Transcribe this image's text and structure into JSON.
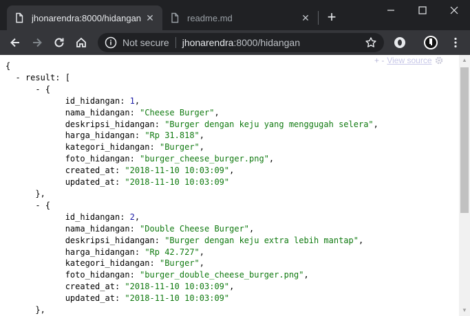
{
  "tabs": [
    {
      "title": "jhonarendra:8000/hidangan",
      "active": true
    },
    {
      "title": "readme.md",
      "active": false
    }
  ],
  "toolbar": {
    "security_label": "Not secure",
    "url_host": "jhonarendra",
    "url_rest": ":8000/hidangan"
  },
  "viewer": {
    "collapse_label": "+ -",
    "view_source_label": "View source"
  },
  "json_doc": {
    "result_key": "result",
    "items": [
      {
        "id_hidangan": "1",
        "nama_hidangan": "\"Cheese Burger\"",
        "deskripsi_hidangan": "\"Burger dengan keju yang menggugah selera\"",
        "harga_hidangan": "\"Rp 31.818\"",
        "kategori_hidangan": "\"Burger\"",
        "foto_hidangan": "\"burger_cheese_burger.png\"",
        "created_at": "\"2018-11-10 10:03:09\"",
        "updated_at": "\"2018-11-10 10:03:09\""
      },
      {
        "id_hidangan": "2",
        "nama_hidangan": "\"Double Cheese Burger\"",
        "deskripsi_hidangan": "\"Burger dengan keju extra lebih mantap\"",
        "harga_hidangan": "\"Rp 42.727\"",
        "kategori_hidangan": "\"Burger\"",
        "foto_hidangan": "\"burger_double_cheese_burger.png\"",
        "created_at": "\"2018-11-10 10:03:09\"",
        "updated_at": "\"2018-11-10 10:03:09\""
      }
    ]
  },
  "colors": {
    "string": "#107a10",
    "number": "#1a1aa6",
    "chrome_dark": "#202124",
    "chrome_toolbar": "#35363a"
  },
  "icons": [
    "page-icon",
    "close-icon",
    "plus-icon",
    "minimize-icon",
    "maximize-icon",
    "window-close-icon",
    "back-arrow-icon",
    "forward-arrow-icon",
    "reload-icon",
    "home-icon",
    "info-icon",
    "star-icon",
    "extension-icon",
    "profile-icon",
    "menu-dots-icon",
    "gear-icon"
  ]
}
